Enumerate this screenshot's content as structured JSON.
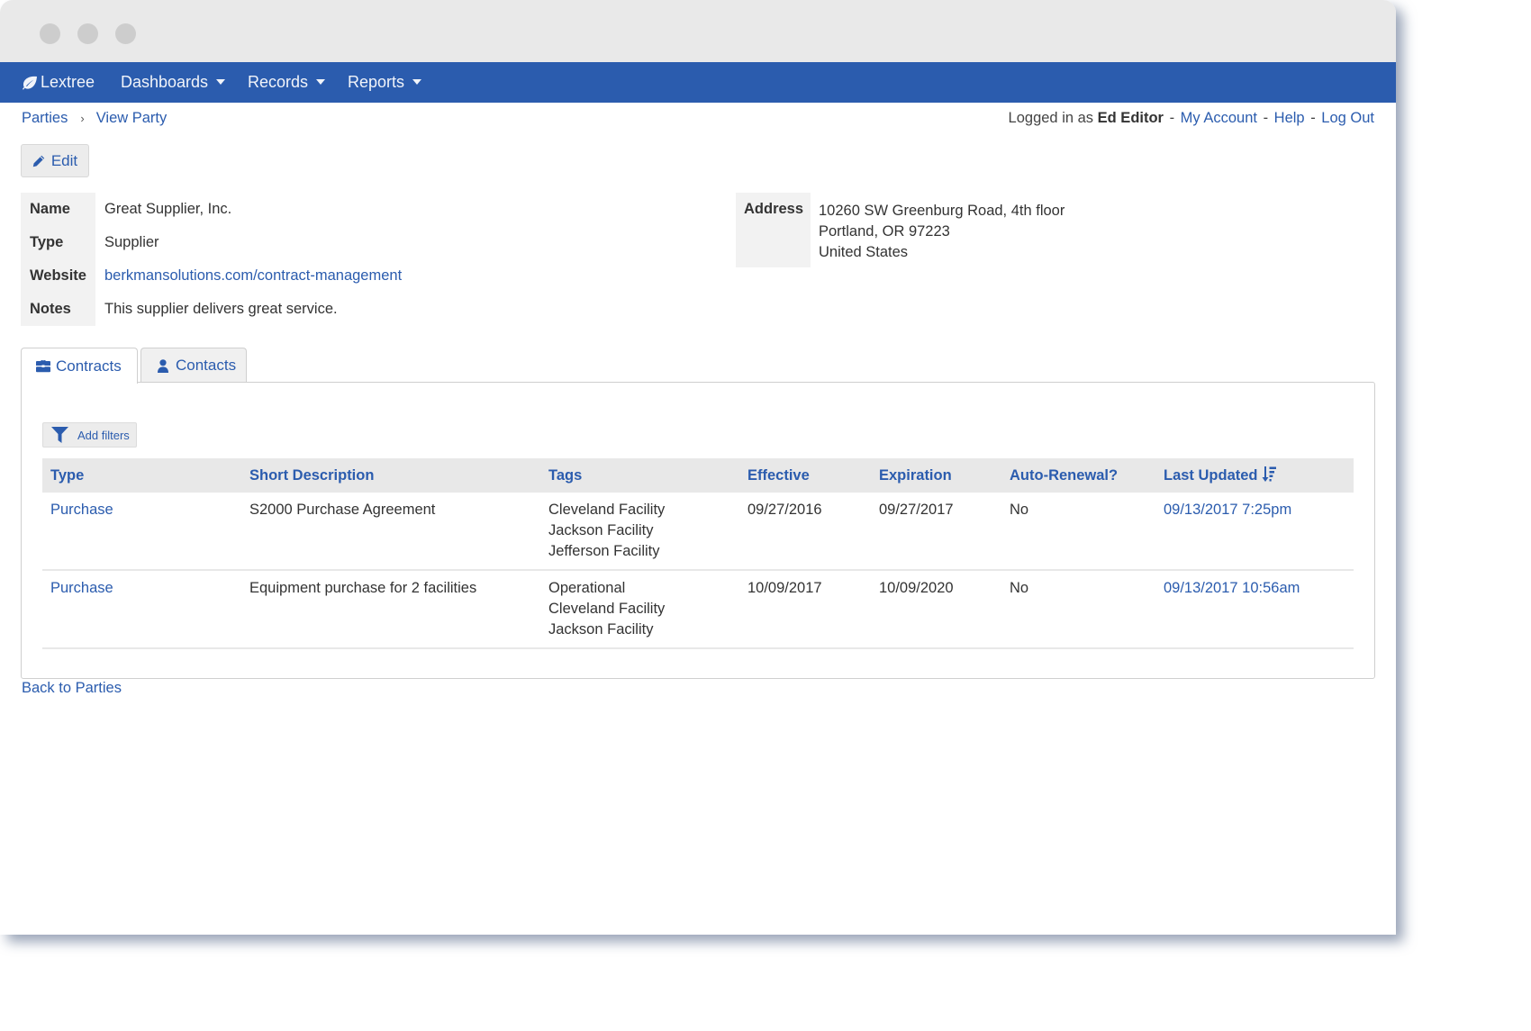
{
  "window": {
    "controls": [
      "close",
      "minimize",
      "maximize"
    ]
  },
  "navbar": {
    "brand": {
      "label": "Lextree",
      "icon": "leaf-icon"
    },
    "menus": [
      {
        "label": "Dashboards",
        "icon": "caret-down-icon"
      },
      {
        "label": "Records",
        "icon": "caret-down-icon"
      },
      {
        "label": "Reports",
        "icon": "caret-down-icon"
      }
    ]
  },
  "breadcrumb": {
    "items": [
      "Parties",
      "View Party"
    ],
    "separator": "›"
  },
  "userbar": {
    "prefix": "Logged in as",
    "user": "Ed Editor",
    "separator": "-",
    "links": [
      "My Account",
      "Help",
      "Log Out"
    ]
  },
  "toolbar": {
    "edit_label": "Edit",
    "edit_icon": "pencil-icon"
  },
  "party": {
    "fields": [
      {
        "label": "Name",
        "value": "Great Supplier, Inc.",
        "is_link": false
      },
      {
        "label": "Type",
        "value": "Supplier",
        "is_link": false
      },
      {
        "label": "Website",
        "value": "berkmansolutions.com/contract-management",
        "is_link": true
      },
      {
        "label": "Notes",
        "value": "This supplier delivers great service.",
        "is_link": false
      }
    ],
    "address": {
      "label": "Address",
      "lines": [
        "10260 SW Greenburg Road, 4th floor",
        "Portland, OR 97223",
        "United States"
      ]
    }
  },
  "tabs": [
    {
      "label": "Contracts",
      "icon": "briefcase-icon",
      "active": true
    },
    {
      "label": "Contacts",
      "icon": "user-icon",
      "active": false
    }
  ],
  "contracts": {
    "filter_label": "Add filters",
    "filter_icon": "filter-icon",
    "columns": [
      "Type",
      "Short Description",
      "Tags",
      "Effective",
      "Expiration",
      "Auto-Renewal?",
      "Last Updated"
    ],
    "sort": {
      "column": "Last Updated",
      "direction": "descending",
      "icon": "sort-amount-down-icon"
    },
    "rows": [
      {
        "type": "Purchase",
        "description": "S2000 Purchase Agreement",
        "tags": [
          "Cleveland Facility",
          "Jackson Facility",
          "Jefferson Facility"
        ],
        "effective": "09/27/2016",
        "expiration": "09/27/2017",
        "auto_renewal": "No",
        "last_updated": "09/13/2017 7:25pm"
      },
      {
        "type": "Purchase",
        "description": "Equipment purchase for 2 facilities",
        "tags": [
          "Operational",
          "Cleveland Facility",
          "Jackson Facility"
        ],
        "effective": "10/09/2017",
        "expiration": "10/09/2020",
        "auto_renewal": "No",
        "last_updated": "09/13/2017 10:56am"
      }
    ]
  },
  "footer": {
    "back_label": "Back to Parties"
  },
  "colors": {
    "navbar": "#2b5cae",
    "link": "#2b5cae",
    "titlebar": "#e9e9e9",
    "label_bg": "#f2f2f2",
    "table_header_bg": "#e8e8e8"
  }
}
